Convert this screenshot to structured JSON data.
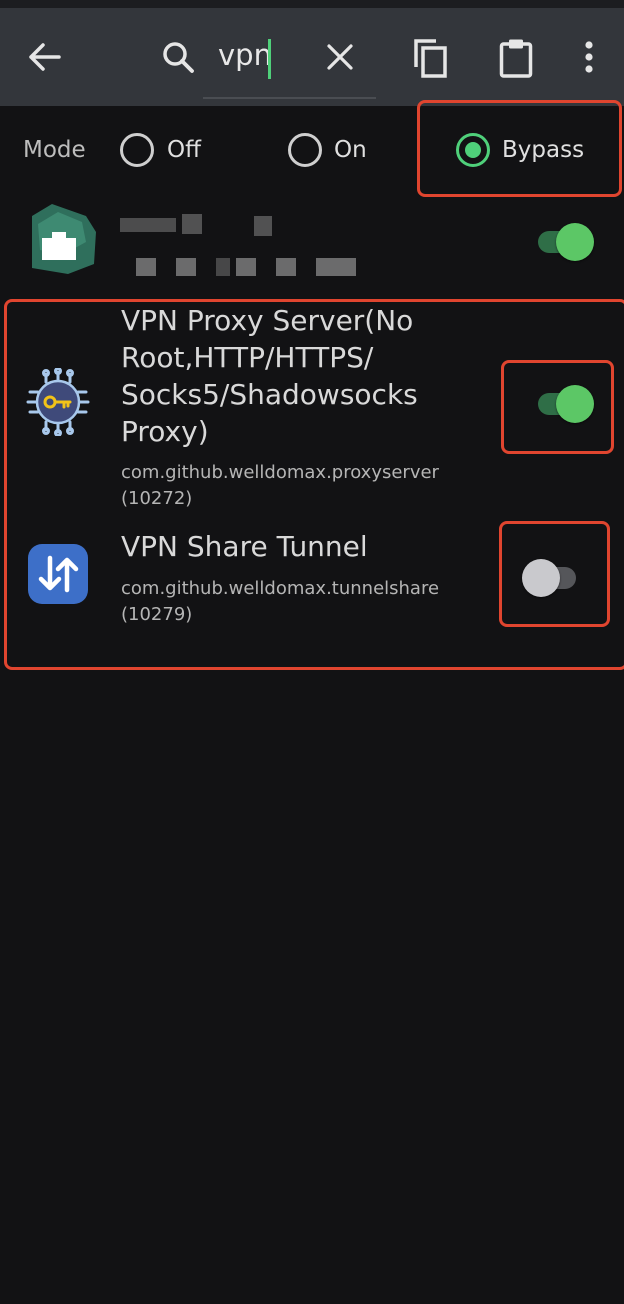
{
  "toolbar": {
    "search_value": "vpn",
    "icons": [
      "back-arrow-icon",
      "search-icon",
      "clear-icon",
      "copy-icon",
      "clipboard-icon",
      "overflow-menu-icon"
    ]
  },
  "mode": {
    "label": "Mode",
    "options": [
      {
        "label": "Off",
        "checked": false
      },
      {
        "label": "On",
        "checked": false
      },
      {
        "label": "Bypass",
        "checked": true
      }
    ]
  },
  "apps": [
    {
      "name": "",
      "package": "",
      "enabled": true,
      "icon": "obscured-app-icon"
    },
    {
      "name": "VPN Proxy Server(No Root,HTTP/HTTPS/ Socks5/Shadowsocks Proxy)",
      "name_lines": [
        "VPN Proxy Server(No",
        "Root,HTTP/HTTPS/",
        "Socks5/Shadowsocks",
        "Proxy)"
      ],
      "package": "com.github.welldomax.proxyserver",
      "uid": "(10272)",
      "enabled": true,
      "icon": "virus-key-icon"
    },
    {
      "name": "VPN Share Tunnel",
      "package": "com.github.welldomax.tunnelshare",
      "uid": "(10279)",
      "enabled": false,
      "icon": "up-down-arrows-icon"
    }
  ],
  "colors": {
    "accent": "#4fd07a",
    "highlight": "#e0452f",
    "toolbar": "#33363b",
    "background": "#121214"
  }
}
